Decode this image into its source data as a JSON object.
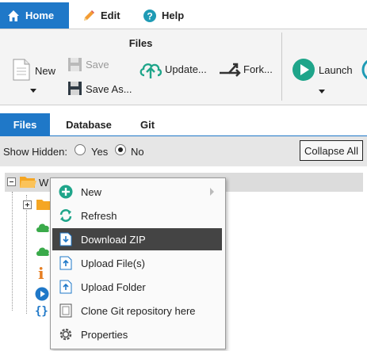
{
  "menu": {
    "tabs": [
      {
        "label": "Home",
        "icon": "home-icon"
      },
      {
        "label": "Edit",
        "icon": "pencil-icon"
      },
      {
        "label": "Help",
        "icon": "help-icon"
      }
    ]
  },
  "ribbon": {
    "files_group_title": "Files",
    "new_label": "New",
    "save_label": "Save",
    "save_as_label": "Save As...",
    "update_label": "Update...",
    "fork_label": "Fork...",
    "launch_label": "Launch"
  },
  "tabs2": [
    {
      "label": "Files"
    },
    {
      "label": "Database"
    },
    {
      "label": "Git"
    }
  ],
  "options": {
    "show_hidden_label": "Show Hidden:",
    "yes_label": "Yes",
    "no_label": "No",
    "selected": "No",
    "collapse_all_label": "Collapse All"
  },
  "tree": {
    "root_label": "W"
  },
  "context_menu": {
    "items": [
      {
        "label": "New",
        "icon": "plus-circle-icon",
        "has_submenu": true
      },
      {
        "label": "Refresh",
        "icon": "refresh-icon"
      },
      {
        "label": "Download ZIP",
        "icon": "download-zip-icon",
        "highlighted": true
      },
      {
        "label": "Upload File(s)",
        "icon": "upload-file-icon"
      },
      {
        "label": "Upload Folder",
        "icon": "upload-folder-icon"
      },
      {
        "label": "Clone Git repository here",
        "icon": "git-clone-icon"
      },
      {
        "label": "Properties",
        "icon": "gear-icon"
      }
    ]
  },
  "colors": {
    "accent": "#1f78c8",
    "menu_highlight": "#444444",
    "green": "#3aaa4a",
    "teal": "#1fa58a",
    "folder": "#f5a623"
  }
}
